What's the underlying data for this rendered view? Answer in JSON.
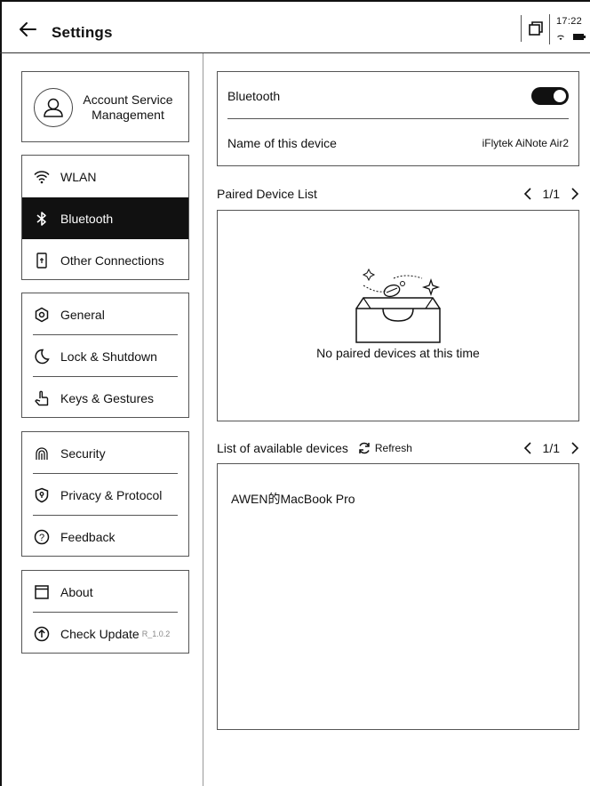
{
  "header": {
    "title": "Settings",
    "time": "17:22"
  },
  "account": {
    "label_line1": "Account Service",
    "label_line2": "Management"
  },
  "sidebar": {
    "group1": [
      {
        "label": "WLAN",
        "icon": "wifi-icon"
      },
      {
        "label": "Bluetooth",
        "icon": "bluetooth-icon",
        "active": true
      },
      {
        "label": "Other Connections",
        "icon": "phone-link-icon"
      }
    ],
    "group2": [
      {
        "label": "General",
        "icon": "hexagon-settings-icon"
      },
      {
        "label": "Lock & Shutdown",
        "icon": "moon-icon"
      },
      {
        "label": "Keys & Gestures",
        "icon": "hand-pointer-icon"
      }
    ],
    "group3": [
      {
        "label": "Security",
        "icon": "fingerprint-icon"
      },
      {
        "label": "Privacy & Protocol",
        "icon": "shield-icon"
      },
      {
        "label": "Feedback",
        "icon": "help-circle-icon"
      }
    ],
    "group4": [
      {
        "label": "About",
        "icon": "info-box-icon"
      },
      {
        "label": "Check Update",
        "icon": "upload-circle-icon",
        "version": "R_1.0.2"
      }
    ]
  },
  "bluetooth": {
    "label": "Bluetooth",
    "enabled": true,
    "device_name_label": "Name of this device",
    "device_name": "iFlytek AiNote Air2"
  },
  "paired": {
    "title": "Paired Device List",
    "page": "1/1",
    "empty_text": "No paired devices at this time"
  },
  "available": {
    "title": "List of available devices",
    "refresh_label": "Refresh",
    "page": "1/1",
    "devices": [
      "AWEN的MacBook Pro"
    ]
  }
}
